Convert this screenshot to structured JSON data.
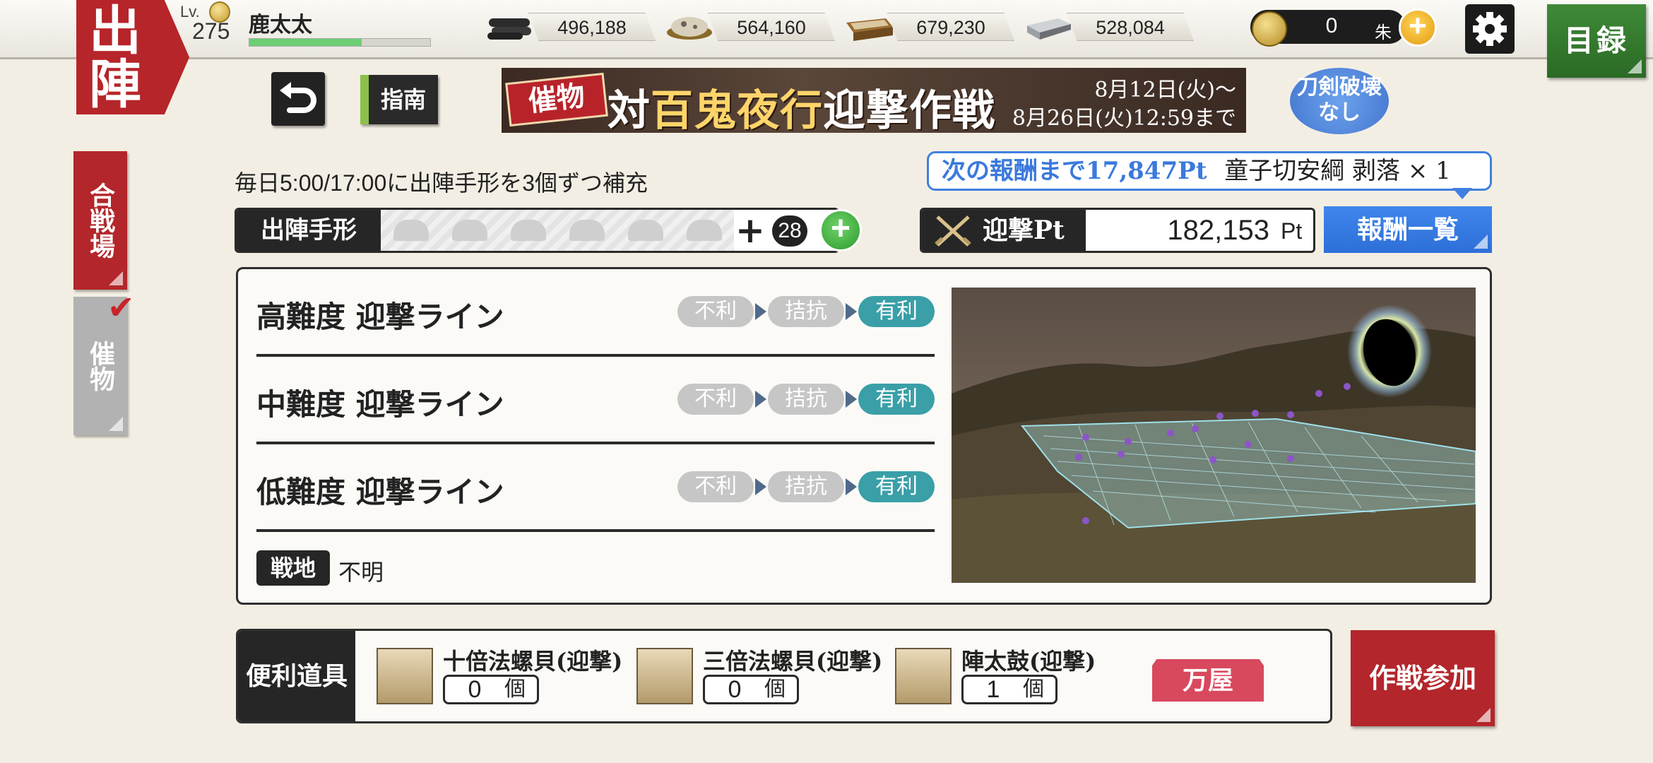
{
  "header": {
    "sortie_tab": "出陣",
    "level_label": "Lv.",
    "level_value": "275",
    "player_name": "鹿太太",
    "exp_progress": 0.62,
    "resources": [
      {
        "icon": "charcoal-icon",
        "value": "496,188"
      },
      {
        "icon": "whetstone-icon",
        "value": "564,160"
      },
      {
        "icon": "cooling-material-icon",
        "value": "679,230"
      },
      {
        "icon": "steel-icon",
        "value": "528,084"
      }
    ],
    "koban_value": "0",
    "koban_unit": "朱",
    "catalog_label": "目録"
  },
  "toolbar": {
    "guide_label": "指南",
    "banner": {
      "tag": "催物",
      "title_prefix": "対",
      "title_highlight": "百鬼夜行",
      "title_suffix": "迎撃作戦",
      "date_start": "8月12日(火)〜",
      "date_end": "8月26日(火)12:59まで"
    },
    "break_badge": "刀剣破壊なし"
  },
  "side_tabs": {
    "battle": "合戦場",
    "event": "催物"
  },
  "sortie_pass": {
    "refill_text": "毎日5:00/17:00に出陣手形を3個ずつ補充",
    "label": "出陣手形",
    "slots": 6,
    "extra_count": "28"
  },
  "points": {
    "next_reward_prefix": "次の報酬まで17,847Pt",
    "next_reward_item": "童子切安綱 剥落 × 1",
    "label": "迎撃Pt",
    "value": "182,153",
    "unit": "Pt",
    "reward_list_label": "報酬一覧"
  },
  "lines": [
    {
      "title": "高難度 迎撃ライン",
      "states": [
        "不利",
        "拮抗",
        "有利"
      ],
      "active": 2
    },
    {
      "title": "中難度 迎撃ライン",
      "states": [
        "不利",
        "拮抗",
        "有利"
      ],
      "active": 2
    },
    {
      "title": "低難度 迎撃ライン",
      "states": [
        "不利",
        "拮抗",
        "有利"
      ],
      "active": 2
    }
  ],
  "battlefield": {
    "label": "戦地",
    "value": "不明"
  },
  "items": {
    "label": "便利道具",
    "list": [
      {
        "name": "十倍法螺貝(迎撃)",
        "qty": "0",
        "unit": "個"
      },
      {
        "name": "三倍法螺貝(迎撃)",
        "qty": "0",
        "unit": "個"
      },
      {
        "name": "陣太鼓(迎撃)",
        "qty": "1",
        "unit": "個"
      }
    ],
    "shop_label": "万屋"
  },
  "join_label": "作戦参加",
  "colors": {
    "accent_red": "#b3262b",
    "reward_blue": "#3f7fe0",
    "favorable_teal": "#3a9fa7",
    "inactive_gray": "#c6c6c6"
  }
}
